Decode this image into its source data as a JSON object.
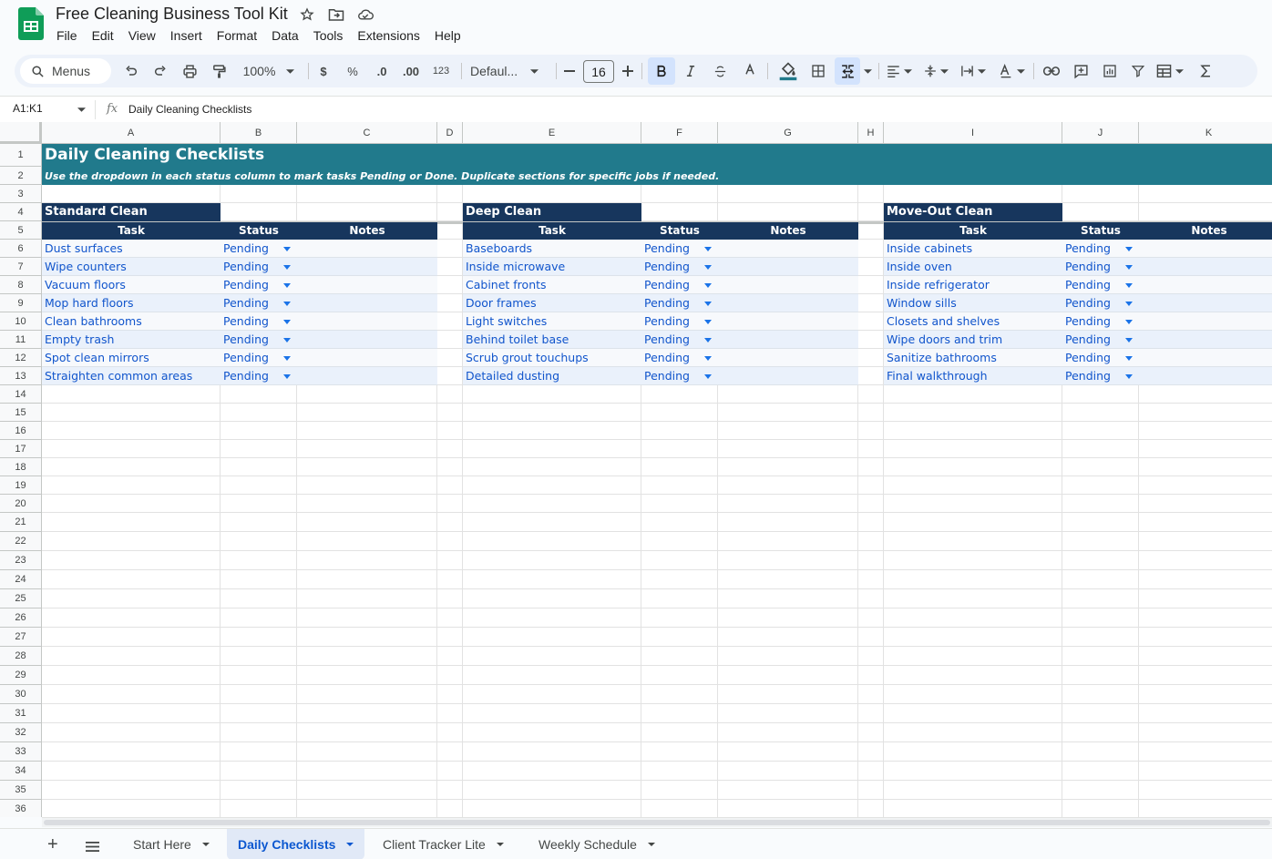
{
  "doc": {
    "title": "Free Cleaning Business Tool Kit",
    "menu": [
      "File",
      "Edit",
      "View",
      "Insert",
      "Format",
      "Data",
      "Tools",
      "Extensions",
      "Help"
    ]
  },
  "toolbar": {
    "menus_label": "Menus",
    "zoom": "100%",
    "currency": "$",
    "percent": "%",
    "dec_decrease": ".0",
    "dec_increase": ".00",
    "number_format": "123",
    "font_family": "Defaul...",
    "font_size": "16",
    "icons": [
      "search-icon",
      "undo-icon",
      "redo-icon",
      "print-icon",
      "paint-format-icon",
      "bold-icon",
      "italic-icon",
      "strikethrough-icon",
      "text-color-icon",
      "fill-color-icon",
      "borders-icon",
      "merge-cells-icon",
      "align-icon",
      "valign-icon",
      "wrap-icon",
      "rotate-icon",
      "link-icon",
      "comment-icon",
      "chart-icon",
      "filter-icon",
      "table-icon",
      "functions-icon"
    ]
  },
  "formula_bar": {
    "name_box": "A1:K1",
    "fx": "fx",
    "content": "Daily Cleaning Checklists"
  },
  "columns": [
    "A",
    "B",
    "C",
    "D",
    "E",
    "F",
    "G",
    "H",
    "I",
    "J",
    "K"
  ],
  "rows": [
    "1",
    "2",
    "3",
    "4",
    "5",
    "6",
    "7",
    "8",
    "9",
    "10",
    "11",
    "12",
    "13",
    "14",
    "15",
    "16",
    "17",
    "18",
    "19",
    "20",
    "21",
    "22",
    "23",
    "24",
    "25",
    "26",
    "27",
    "28",
    "29",
    "30",
    "31",
    "32",
    "33",
    "34",
    "35",
    "36"
  ],
  "sheet": {
    "title": "Daily Cleaning Checklists",
    "subtitle": "Use the dropdown in each status column to mark tasks Pending or Done. Duplicate sections for specific jobs if needed.",
    "header_task": "Task",
    "header_status": "Status",
    "header_notes": "Notes",
    "sections": [
      {
        "name": "Standard Clean",
        "tasks": [
          "Dust surfaces",
          "Wipe counters",
          "Vacuum floors",
          "Mop hard floors",
          "Clean bathrooms",
          "Empty trash",
          "Spot clean mirrors",
          "Straighten common areas"
        ],
        "status": [
          "Pending",
          "Pending",
          "Pending",
          "Pending",
          "Pending",
          "Pending",
          "Pending",
          "Pending"
        ]
      },
      {
        "name": "Deep Clean",
        "tasks": [
          "Baseboards",
          "Inside microwave",
          "Cabinet fronts",
          "Door frames",
          "Light switches",
          "Behind toilet base",
          "Scrub grout touchups",
          "Detailed dusting"
        ],
        "status": [
          "Pending",
          "Pending",
          "Pending",
          "Pending",
          "Pending",
          "Pending",
          "Pending",
          "Pending"
        ]
      },
      {
        "name": "Move-Out Clean",
        "tasks": [
          "Inside cabinets",
          "Inside oven",
          "Inside refrigerator",
          "Window sills",
          "Closets and shelves",
          "Wipe doors and trim",
          "Sanitize bathrooms",
          "Final walkthrough"
        ],
        "status": [
          "Pending",
          "Pending",
          "Pending",
          "Pending",
          "Pending",
          "Pending",
          "Pending",
          "Pending"
        ]
      }
    ]
  },
  "tabs": {
    "items": [
      "Start Here",
      "Daily Checklists",
      "Client Tracker Lite",
      "Weekly Schedule"
    ],
    "active": "Daily Checklists"
  },
  "colors": {
    "title_band": "#217a8c",
    "section_header": "#17365d",
    "link_text": "#1155cc",
    "row_alt": "#eaf1fb",
    "accent": "#0b57d0"
  }
}
